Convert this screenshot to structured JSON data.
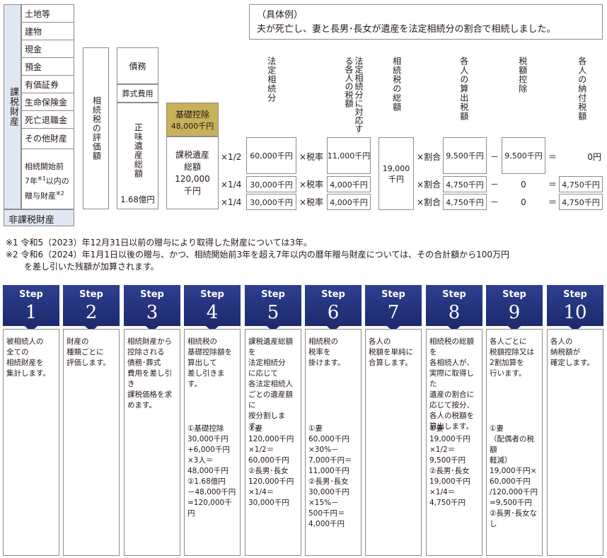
{
  "taxable": {
    "label": "課税財産",
    "items": [
      "土地等",
      "建物",
      "現金",
      "預金",
      "有価証券",
      "生命保険金",
      "死亡退職金",
      "その他財産"
    ],
    "gift_line1": "相続開始前",
    "gift_line2": "7年",
    "gift_note1": "※1",
    "gift_line2b": "以内の",
    "gift_line3": "贈与財産",
    "gift_note2": "※2"
  },
  "non_taxable": "非課税財産",
  "evaluation": "相続税の評価額",
  "debts": "債務",
  "funeral": "葬式費用",
  "net_estate": "正味遺産総額",
  "net_estate_value": "1.68億円",
  "basic_deduction": {
    "label": "基礎控除",
    "value": "48,000千円",
    "color": "#c7b15a"
  },
  "taxable_total": {
    "label1": "課税遺産",
    "label2": "総額",
    "value1": "120,000",
    "value2": "千円"
  },
  "example": {
    "title": "（具体例）",
    "text": "夫が死亡し、妻と長男･長女が遺産を法定相続分の割合で相続しました。"
  },
  "columns": {
    "legal_share": "法定相続分",
    "tax_per_share": "法定相続分に対応する各人の税額",
    "total_tax": "相続税の総額",
    "individual_tax": "各人の算出税額",
    "tax_credit": "税額控除",
    "payable_tax": "各人の納付税額"
  },
  "rows": [
    {
      "ratio": "×1/2",
      "share": "60,000千円",
      "rate": "×税率",
      "tax": "11,000千円",
      "alloc": "×割合",
      "calc": "9,500千円",
      "minus": "－",
      "credit": "9,500千円",
      "eq": "＝",
      "pay": "0円"
    },
    {
      "ratio": "×1/4",
      "share": "30,000千円",
      "rate": "×税率",
      "tax": "4,000千円",
      "alloc": "×割合",
      "calc": "4,750千円",
      "minus": "－",
      "credit": "0",
      "eq": "＝",
      "pay": "4,750千円"
    },
    {
      "ratio": "×1/4",
      "share": "30,000千円",
      "rate": "×税率",
      "tax": "4,000千円",
      "alloc": "×割合",
      "calc": "4,750千円",
      "minus": "－",
      "credit": "0",
      "eq": "＝",
      "pay": "4,750千円"
    }
  ],
  "total_tax_value": {
    "line1": "19,000",
    "line2": "千円"
  },
  "notes": [
    "※1 令和5（2023）年12月31日以前の贈与により取得した財産については3年。",
    "※2 令和6（2024）年1月1日以後の贈与、かつ、相続開始前3年を超え7年以内の暦年贈与財産については、その合計額から100万円",
    "を差し引いた残額が加算されます。"
  ],
  "steps": [
    {
      "label": "Step",
      "num": "1",
      "desc": "被相続人の\n全ての\n相続財産を\n集計します。",
      "ex": ""
    },
    {
      "label": "Step",
      "num": "2",
      "desc": "財産の\n種類ごとに\n評価します。",
      "ex": ""
    },
    {
      "label": "Step",
      "num": "3",
      "desc": "相続財産から\n控除される\n債務･葬式\n費用を差し引き\n課税価格を求\nめます。",
      "ex": ""
    },
    {
      "label": "Step",
      "num": "4",
      "desc": "相続税の\n基礎控除額を\n算出して\n差し引きます。",
      "ex": "①基礎控除\n30,000千円\n+6,000千円\n×3人＝\n48,000千円\n②1.68億円\n－48,000千円\n=120,000千円"
    },
    {
      "label": "Step",
      "num": "5",
      "desc": "課税遺産総額を\n法定相続分\nに応じて\n各法定相続人\nごとの遺産額に\n按分割します。",
      "ex": "①妻\n120,000千円\n×1/2＝\n60,000千円\n②長男･長女\n120,000千円\n×1/4＝\n30,000千円"
    },
    {
      "label": "Step",
      "num": "6",
      "desc": "相続税の\n税率を\n掛けます。",
      "ex": "①妻\n60,000千円\n×30%－\n7,000千円＝\n11,000千円\n②長男･長女\n30,000千円\n×15%－\n500千円＝\n4,000千円"
    },
    {
      "label": "Step",
      "num": "7",
      "desc": "各人の\n税額を単純に\n合算します。",
      "ex": ""
    },
    {
      "label": "Step",
      "num": "8",
      "desc": "相続税の総額を\n各相続人が、\n実際に取得した\n遺産の割合に\n応じて按分、\n各人の税額を\n算出します。",
      "ex": "①妻\n19,000千円\n×1/2＝\n9,500千円\n②長男･長女\n19,000千円\n×1/4＝\n4,750千円"
    },
    {
      "label": "Step",
      "num": "9",
      "desc": "各人ごとに\n税額控除又は\n2割加算を\n行います。",
      "ex": "①妻\n（配偶者の税額\n軽減）\n19,000千円×\n60,000千円\n/120,000千円\n=9,500千円\n②長男･長女なし"
    },
    {
      "label": "Step",
      "num": "10",
      "desc": "各人の\n納税額が\n確定します。",
      "ex": ""
    }
  ]
}
